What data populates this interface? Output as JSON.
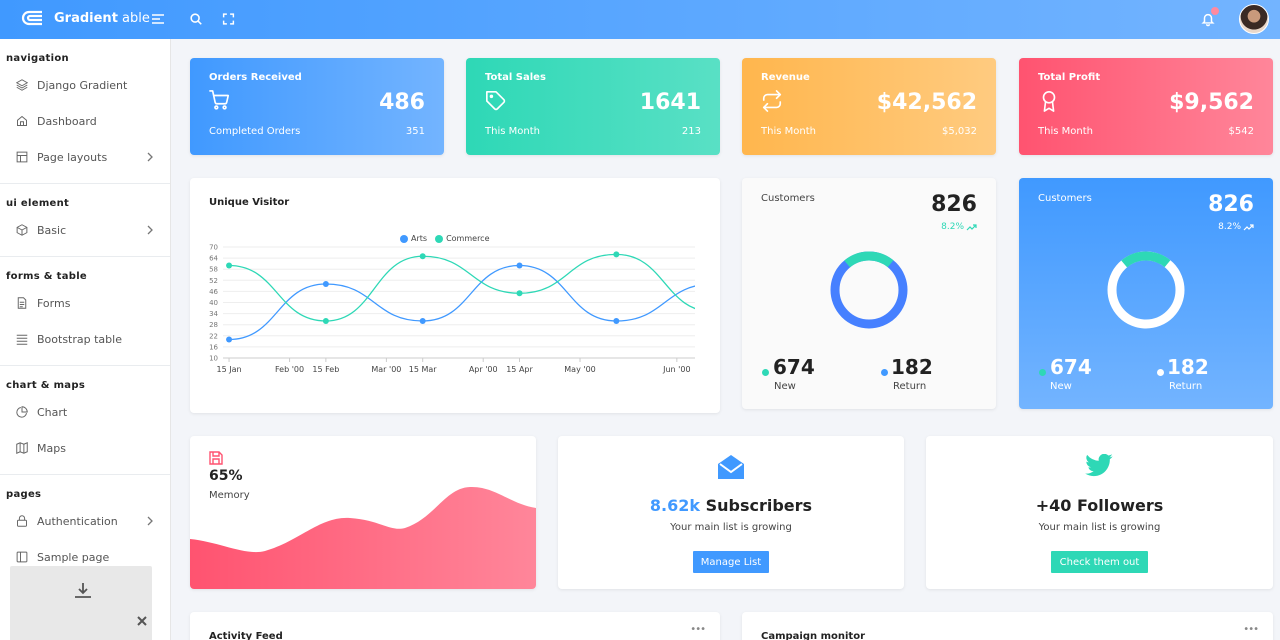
{
  "brand": {
    "name_bold": "Gradient",
    "name_thin": " able"
  },
  "colors": {
    "blue": "#4099ff",
    "green": "#2ed8b6",
    "orange": "#ffb64d",
    "red": "#ff5370"
  },
  "sidebar": {
    "sections": [
      {
        "caption": "navigation",
        "items": [
          {
            "label": "Django Gradient",
            "icon": "layers-icon",
            "chevron": false
          },
          {
            "label": "Dashboard",
            "icon": "home-icon",
            "chevron": false
          },
          {
            "label": "Page layouts",
            "icon": "layout-icon",
            "chevron": true
          }
        ]
      },
      {
        "caption": "ui element",
        "items": [
          {
            "label": "Basic",
            "icon": "box-icon",
            "chevron": true
          }
        ]
      },
      {
        "caption": "forms & table",
        "items": [
          {
            "label": "Forms",
            "icon": "file-text-icon",
            "chevron": false
          },
          {
            "label": "Bootstrap table",
            "icon": "list-icon",
            "chevron": false
          }
        ]
      },
      {
        "caption": "chart & maps",
        "items": [
          {
            "label": "Chart",
            "icon": "pie-chart-icon",
            "chevron": false
          },
          {
            "label": "Maps",
            "icon": "map-icon",
            "chevron": false
          }
        ]
      },
      {
        "caption": "pages",
        "items": [
          {
            "label": "Authentication",
            "icon": "lock-icon",
            "chevron": true
          },
          {
            "label": "Sample page",
            "icon": "sidebar-icon",
            "chevron": false
          }
        ]
      }
    ]
  },
  "stats": [
    {
      "title": "Orders Received",
      "icon": "cart-icon",
      "value": "486",
      "sub": "Completed Orders",
      "sub_value": "351"
    },
    {
      "title": "Total Sales",
      "icon": "tag-icon",
      "value": "1641",
      "sub": "This Month",
      "sub_value": "213"
    },
    {
      "title": "Revenue",
      "icon": "repeat-icon",
      "value": "$42,562",
      "sub": "This Month",
      "sub_value": "$5,032"
    },
    {
      "title": "Total Profit",
      "icon": "award-icon",
      "value": "$9,562",
      "sub": "This Month",
      "sub_value": "$542"
    }
  ],
  "chart_data": {
    "type": "line",
    "title": "Unique Visitor",
    "xlabel": "",
    "ylabel": "",
    "x_ticks": [
      "15 Jan",
      "Feb '00",
      "15 Feb",
      "Mar '00",
      "15 Mar",
      "Apr '00",
      "15 Apr",
      "May '00",
      "Jun '00"
    ],
    "x_tick_pos": [
      0,
      1,
      1.6,
      2.6,
      3.2,
      4.2,
      4.8,
      5.8,
      7.4
    ],
    "y_ticks": [
      10,
      16,
      22,
      28,
      34,
      40,
      46,
      52,
      58,
      64,
      70
    ],
    "ylim": [
      10,
      70
    ],
    "xlim": [
      -0.1,
      7.7
    ],
    "series": [
      {
        "name": "Arts",
        "color": "#4099ff",
        "x": [
          0,
          1.6,
          3.2,
          4.8,
          6.4,
          8
        ],
        "values": [
          20,
          50,
          30,
          60,
          30,
          50
        ]
      },
      {
        "name": "Commerce",
        "color": "#2ed8b6",
        "x": [
          0,
          1.6,
          3.2,
          4.8,
          6.4,
          8
        ],
        "values": [
          60,
          30,
          65,
          45,
          66,
          35
        ]
      }
    ]
  },
  "customers": [
    {
      "title": "Customers",
      "value": "826",
      "change": "8.2%",
      "new_value": "674",
      "new_label": "New",
      "return_value": "182",
      "return_label": "Return",
      "new_fraction": 0.22
    },
    {
      "title": "Customers",
      "value": "826",
      "change": "8.2%",
      "new_value": "674",
      "new_label": "New",
      "return_value": "182",
      "return_label": "Return",
      "new_fraction": 0.22
    }
  ],
  "memory": {
    "value": "65%",
    "label": "Memory",
    "icon": "save-icon"
  },
  "subscribers": {
    "count": "8.62k",
    "label": " Subscribers",
    "sub": "Your main list is growing",
    "button": "Manage List",
    "icon": "mail-open-icon"
  },
  "followers": {
    "count": "+40 Followers",
    "sub": "Your main list is growing",
    "button": "Check them out",
    "icon": "twitter-icon"
  },
  "bottom": {
    "activity": "Activity Feed",
    "campaign": "Campaign monitor"
  }
}
